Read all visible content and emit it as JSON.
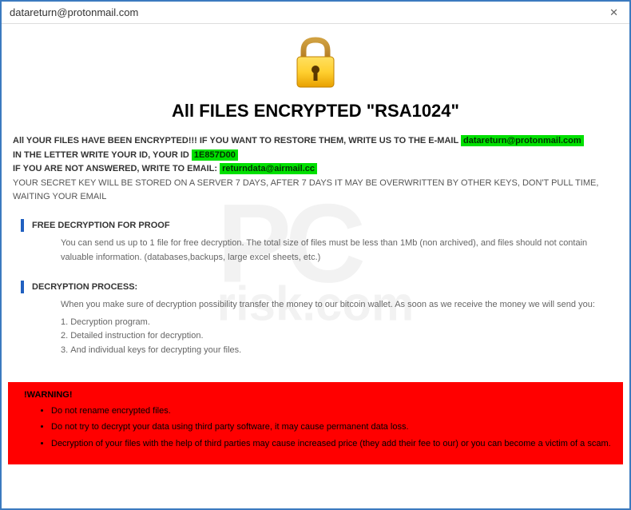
{
  "titlebar": {
    "title": "datareturn@protonmail.com",
    "close": "✕"
  },
  "heading": "All FILES ENCRYPTED \"RSA1024\"",
  "intro": {
    "line1_prefix": "All YOUR FILES HAVE BEEN ENCRYPTED!!! IF YOU WANT TO RESTORE THEM, WRITE US TO THE E-MAIL ",
    "email1": "datareturn@protonmail.com",
    "line2_prefix": "IN THE LETTER WRITE YOUR ID, YOUR ID ",
    "user_id": "1E857D00",
    "line3_prefix": "IF YOU ARE NOT ANSWERED, WRITE TO EMAIL: ",
    "email2": "returndata@airmail.cc",
    "line4": "YOUR SECRET KEY WILL BE STORED ON A SERVER 7 DAYS, AFTER 7 DAYS IT MAY BE OVERWRITTEN BY OTHER KEYS, DON'T PULL TIME, WAITING YOUR EMAIL"
  },
  "section_free": {
    "title": "FREE DECRYPTION FOR PROOF",
    "body": "You can send us up to 1 file for free decryption. The total size of files must be less than 1Mb (non archived), and files should not contain valuable information. (databases,backups, large excel sheets, etc.)"
  },
  "section_process": {
    "title": "DECRYPTION PROCESS:",
    "intro": "When you make sure of decryption possibility transfer the money to our bitcoin wallet. As soon as we receive the money we will send you:",
    "items": [
      "Decryption program.",
      "Detailed instruction for decryption.",
      "And individual keys for decrypting your files."
    ]
  },
  "warning": {
    "title": "!WARNING!",
    "items": [
      "Do not rename encrypted files.",
      "Do not try to decrypt your data using third party software, it may cause permanent data loss.",
      "Decryption of your files with the help of third parties may cause increased price (they add their fee to our) or you can become a victim of a scam."
    ]
  },
  "watermark": {
    "main": "PC",
    "sub": "risk.com"
  }
}
